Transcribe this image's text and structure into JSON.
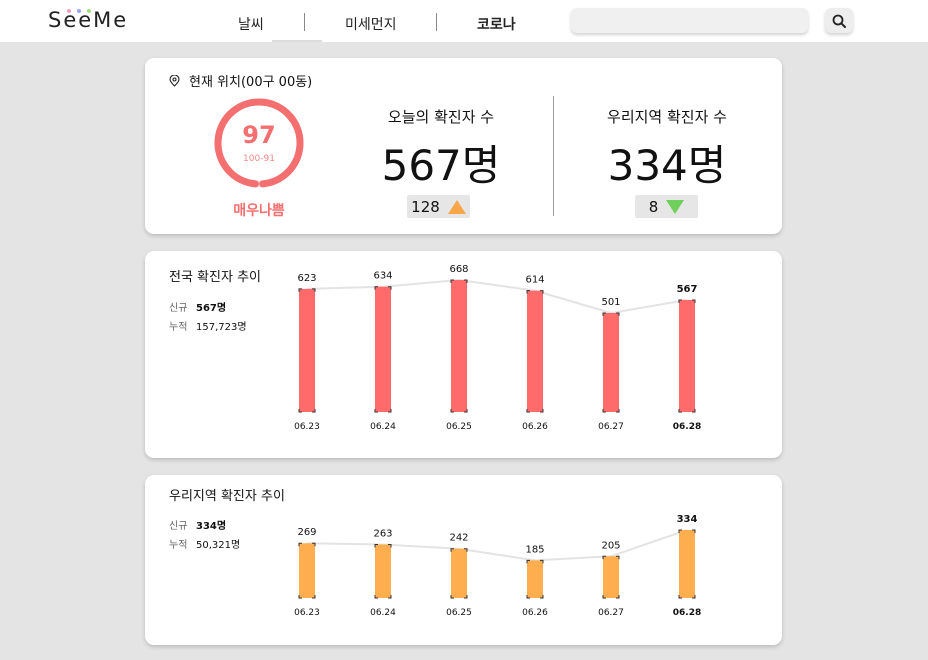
{
  "header": {
    "logo": "SeeMe",
    "nav": [
      "날씨",
      "미세먼지",
      "코로나"
    ],
    "active_nav": "코로나",
    "search": {
      "value": "",
      "placeholder": ""
    },
    "search_icon": "search-icon"
  },
  "summary_card": {
    "location_icon": "location-pin-icon",
    "location": "현재 위치(00구 00동)",
    "gauge": {
      "value": "97",
      "range": "100-91",
      "status": "매우나쁨",
      "level": 0.97,
      "color": "#f46f6f"
    },
    "today": {
      "label": "오늘의 확진자 수",
      "value": "567명",
      "change": "128",
      "direction": "up",
      "arrow_color": "#f7a64a"
    },
    "region": {
      "label": "우리지역 확진자 수",
      "value": "334명",
      "change": "8",
      "direction": "down",
      "arrow_color": "#6ecf5a"
    }
  },
  "national": {
    "title": "전국 확진자 추이",
    "new_label": "신규",
    "new_value": "567명",
    "total_label": "누적",
    "total_value": "157,723명"
  },
  "regional": {
    "title": "우리지역 확진자 추이",
    "new_label": "신규",
    "new_value": "334명",
    "total_label": "누적",
    "total_value": "50,321명"
  },
  "chart_data": [
    {
      "type": "bar",
      "title": "전국 확진자 추이",
      "categories": [
        "06.23",
        "06.24",
        "06.25",
        "06.26",
        "06.27",
        "06.28"
      ],
      "values": [
        623,
        634,
        668,
        614,
        501,
        567
      ],
      "highlight_index": 5,
      "bar_color": "#ff6b6b",
      "trend_line": true
    },
    {
      "type": "bar",
      "title": "우리지역 확진자 추이",
      "categories": [
        "06.23",
        "06.24",
        "06.25",
        "06.26",
        "06.27",
        "06.28"
      ],
      "values": [
        269,
        263,
        242,
        185,
        205,
        334
      ],
      "highlight_index": 5,
      "bar_color": "#ffae4f",
      "trend_line": true
    }
  ]
}
